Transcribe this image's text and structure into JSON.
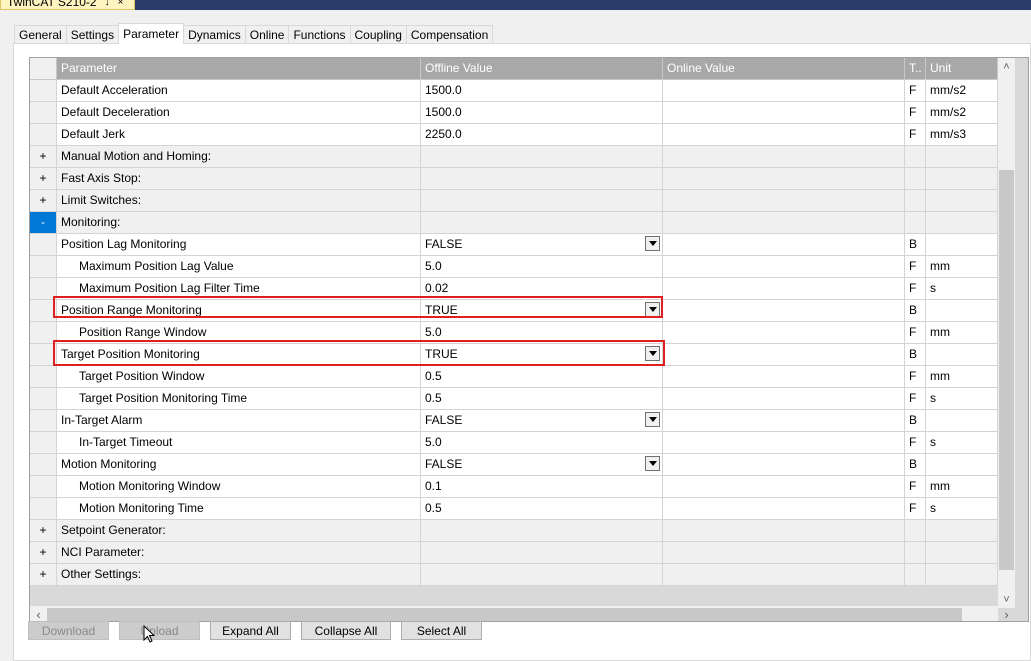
{
  "doc_tab": {
    "title": "TwinCAT S210-2",
    "pin": "↓",
    "close": "×"
  },
  "tabs": [
    "General",
    "Settings",
    "Parameter",
    "Dynamics",
    "Online",
    "Functions",
    "Coupling",
    "Compensation"
  ],
  "active_tab": "Parameter",
  "columns": {
    "parameter": "Parameter",
    "offline": "Offline Value",
    "online": "Online Value",
    "type": "T..",
    "unit": "Unit"
  },
  "rows": [
    {
      "expander": "",
      "name": "Default Acceleration",
      "offline": "1500.0",
      "online": "",
      "type": "F",
      "unit": "mm/s2"
    },
    {
      "expander": "",
      "name": "Default Deceleration",
      "offline": "1500.0",
      "online": "",
      "type": "F",
      "unit": "mm/s2"
    },
    {
      "expander": "",
      "name": "Default Jerk",
      "offline": "2250.0",
      "online": "",
      "type": "F",
      "unit": "mm/s3"
    },
    {
      "expander": "+",
      "name": "Manual Motion and Homing:",
      "offline": "",
      "online": "",
      "type": "",
      "unit": ""
    },
    {
      "expander": "+",
      "name": "Fast Axis Stop:",
      "offline": "",
      "online": "",
      "type": "",
      "unit": ""
    },
    {
      "expander": "+",
      "name": "Limit Switches:",
      "offline": "",
      "online": "",
      "type": "",
      "unit": ""
    },
    {
      "expander": "-",
      "name": "Monitoring:",
      "offline": "",
      "online": "",
      "type": "",
      "unit": ""
    },
    {
      "expander": "",
      "name": "Position Lag Monitoring",
      "offline": "FALSE",
      "online": "",
      "type": "B",
      "unit": ""
    },
    {
      "expander": "",
      "name": "Maximum Position Lag Value",
      "offline": "5.0",
      "online": "",
      "type": "F",
      "unit": "mm"
    },
    {
      "expander": "",
      "name": "Maximum Position Lag Filter Time",
      "offline": "0.02",
      "online": "",
      "type": "F",
      "unit": "s"
    },
    {
      "expander": "",
      "name": "Position Range Monitoring",
      "offline": "TRUE",
      "online": "",
      "type": "B",
      "unit": ""
    },
    {
      "expander": "",
      "name": "Position Range Window",
      "offline": "5.0",
      "online": "",
      "type": "F",
      "unit": "mm"
    },
    {
      "expander": "",
      "name": "Target Position Monitoring",
      "offline": "TRUE",
      "online": "",
      "type": "B",
      "unit": ""
    },
    {
      "expander": "",
      "name": "Target Position Window",
      "offline": "0.5",
      "online": "",
      "type": "F",
      "unit": "mm"
    },
    {
      "expander": "",
      "name": "Target Position Monitoring Time",
      "offline": "0.5",
      "online": "",
      "type": "F",
      "unit": "s"
    },
    {
      "expander": "",
      "name": "In-Target Alarm",
      "offline": "FALSE",
      "online": "",
      "type": "B",
      "unit": ""
    },
    {
      "expander": "",
      "name": "In-Target Timeout",
      "offline": "5.0",
      "online": "",
      "type": "F",
      "unit": "s"
    },
    {
      "expander": "",
      "name": "Motion Monitoring",
      "offline": "FALSE",
      "online": "",
      "type": "B",
      "unit": ""
    },
    {
      "expander": "",
      "name": "Motion Monitoring Window",
      "offline": "0.1",
      "online": "",
      "type": "F",
      "unit": "mm"
    },
    {
      "expander": "",
      "name": "Motion Monitoring Time",
      "offline": "0.5",
      "online": "",
      "type": "F",
      "unit": "s"
    },
    {
      "expander": "+",
      "name": "Setpoint Generator:",
      "offline": "",
      "online": "",
      "type": "",
      "unit": ""
    },
    {
      "expander": "+",
      "name": "NCI Parameter:",
      "offline": "",
      "online": "",
      "type": "",
      "unit": ""
    },
    {
      "expander": "+",
      "name": "Other Settings:",
      "offline": "",
      "online": "",
      "type": "",
      "unit": ""
    }
  ],
  "scroll_glyphs": {
    "up": "˄",
    "down": "˅",
    "left": "‹",
    "right": "›"
  },
  "buttons": [
    "Download",
    "Upload",
    "Expand All",
    "Collapse All",
    "Select All"
  ],
  "highlight_color": "#e02020",
  "icons": {
    "dropdown": "chevron-down-icon",
    "cursor": "mouse-pointer-icon"
  }
}
